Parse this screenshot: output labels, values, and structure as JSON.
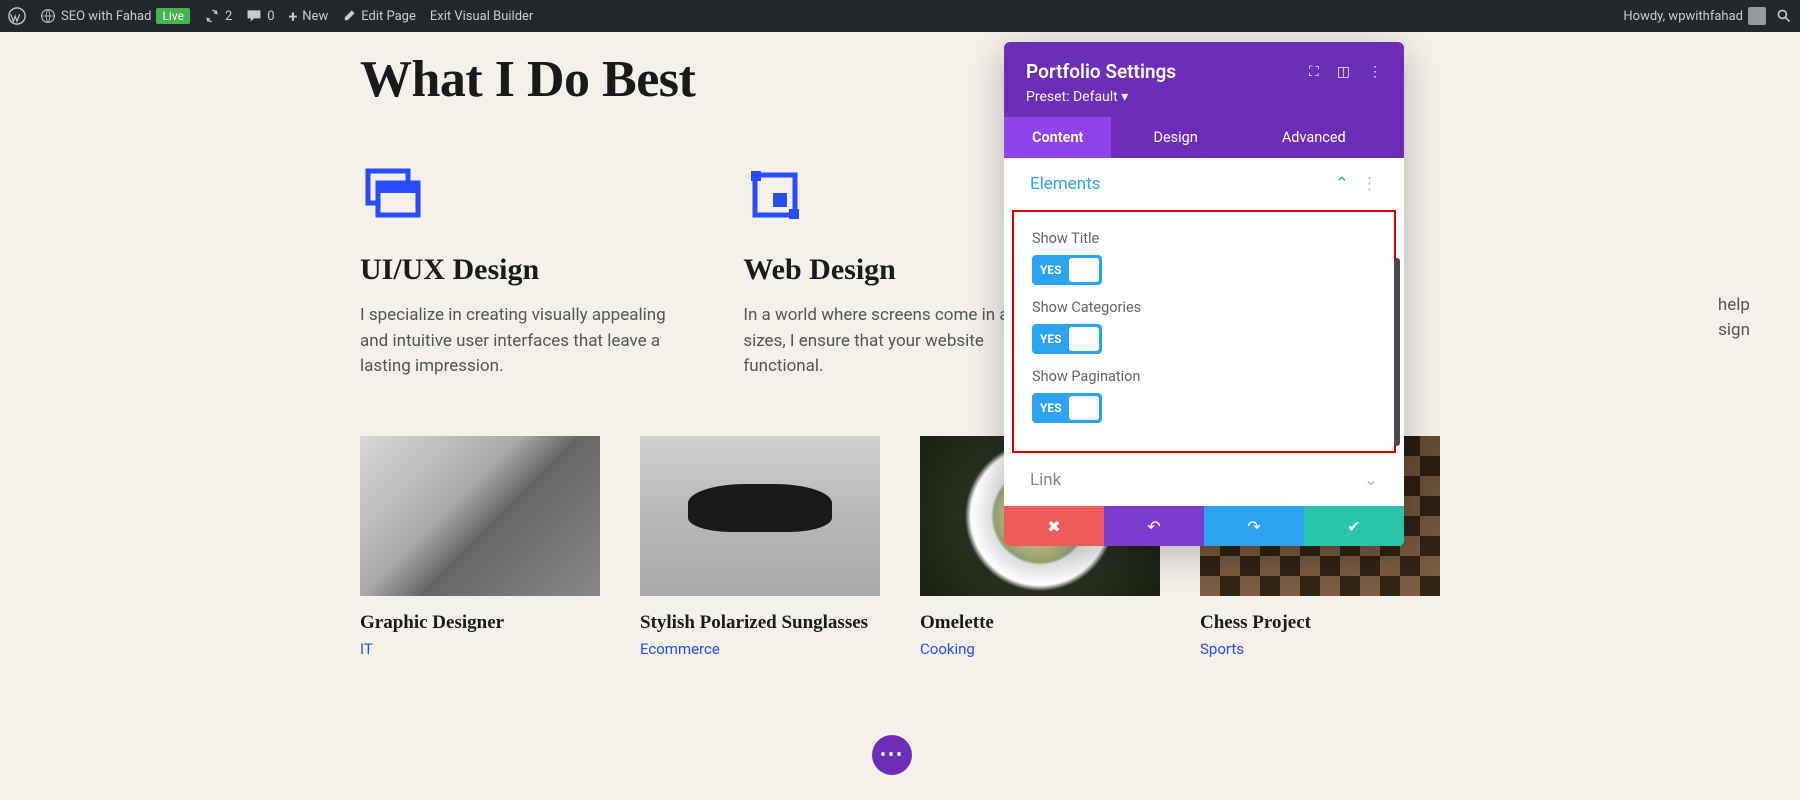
{
  "adminbar": {
    "site_name": "SEO with Fahad",
    "live_badge": "Live",
    "updates_count": "2",
    "comments_count": "0",
    "new_label": "New",
    "edit_page_label": "Edit Page",
    "exit_vb_label": "Exit Visual Builder",
    "howdy": "Howdy, wpwithfahad"
  },
  "hero_title": "What I Do Best",
  "services": [
    {
      "title": "UI/UX Design",
      "desc": "I specialize in creating visually appealing and intuitive user interfaces that leave a lasting impression."
    },
    {
      "title": "Web Design",
      "desc": "In a world where screens come in all and sizes, I ensure that your website functional."
    },
    {
      "title_hidden": "",
      "desc_hidden_1": " help",
      "desc_hidden_2": "sign"
    }
  ],
  "portfolio": [
    {
      "title": "Graphic Designer",
      "category": "IT"
    },
    {
      "title": "Stylish Polarized Sunglasses",
      "category": "Ecommerce"
    },
    {
      "title": "Omelette",
      "category": "Cooking"
    },
    {
      "title": "Chess Project",
      "category": "Sports"
    }
  ],
  "panel": {
    "title": "Portfolio Settings",
    "preset": "Preset: Default",
    "tabs": {
      "content": "Content",
      "design": "Design",
      "advanced": "Advanced"
    },
    "sections": {
      "elements": "Elements",
      "link": "Link"
    },
    "toggles": {
      "show_title": {
        "label": "Show Title",
        "value": "YES"
      },
      "show_categories": {
        "label": "Show Categories",
        "value": "YES"
      },
      "show_pagination": {
        "label": "Show Pagination",
        "value": "YES"
      }
    }
  },
  "fab": "• • •",
  "colors": {
    "accent_purple": "#6c2eb9",
    "accent_purple_light": "#8e44ec",
    "divi_blue": "#2ea3f2",
    "link_blue": "#2a4cff",
    "danger": "#ef5a5a",
    "success": "#29c4a9"
  }
}
